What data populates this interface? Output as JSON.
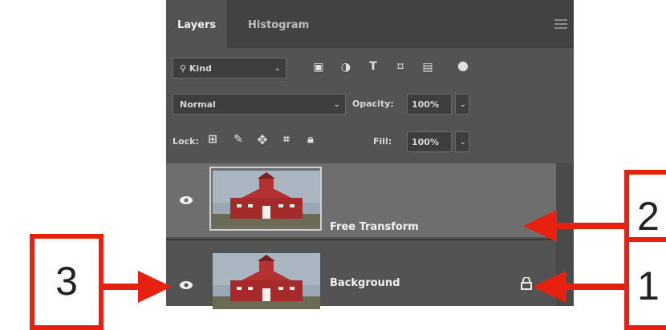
{
  "tabs": [
    {
      "label": "Layers",
      "active": true
    },
    {
      "label": "Histogram",
      "active": false
    }
  ],
  "filter": {
    "label": "Kind",
    "icons": [
      "image-filter-icon",
      "adjustment-filter-icon",
      "type-filter-icon",
      "shape-filter-icon",
      "smart-object-filter-icon",
      "toggle-filter-icon"
    ]
  },
  "blend": {
    "mode": "Normal",
    "opacity_label": "Opacity:",
    "opacity_value": "100%"
  },
  "lock": {
    "label": "Lock:",
    "fill_label": "Fill:",
    "fill_value": "100%"
  },
  "layers": [
    {
      "name": "Free Transform",
      "selected": true,
      "locked": false
    },
    {
      "name": "Background",
      "selected": false,
      "locked": true
    }
  ],
  "callouts": [
    "1",
    "2",
    "3"
  ],
  "colors": {
    "panel": "#535353",
    "tab_bar": "#424242",
    "selected_layer": "#6e6e6e",
    "callout_red": "#e8200f"
  }
}
